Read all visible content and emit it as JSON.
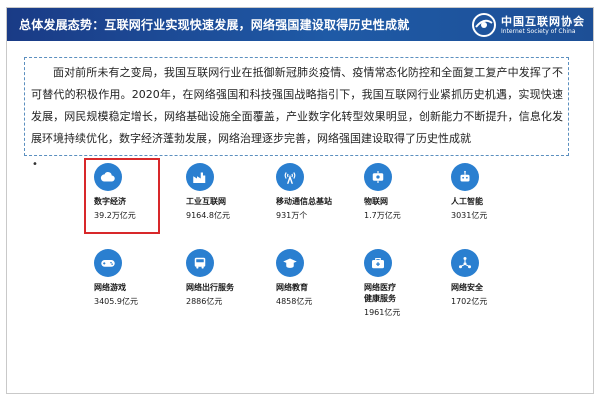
{
  "header": {
    "title": "总体发展态势：互联网行业实现快速发展，网络强国建设取得历史性成就",
    "logo_cn": "中国互联网协会",
    "logo_en": "Internet Society of China"
  },
  "body": {
    "paragraph": "面对前所未有之变局，我国互联网行业在抵御新冠肺炎疫情、疫情常态化防控和全面复工复产中发挥了不可替代的积极作用。2020年，在网络强国和科技强国战略指引下，我国互联网行业紧抓历史机遇，实现快速发展，网民规模稳定增长，网络基础设施全面覆盖，产业数字化转型效果明显，创新能力不断提升，信息化发展环境持续优化，数字经济蓬勃发展，网络治理逐步完善，网络强国建设取得了历史性成就",
    "bullet": "•"
  },
  "stats": [
    {
      "label": "数字经济",
      "value": "39.2万亿元",
      "icon": "cloud-icon"
    },
    {
      "label": "工业互联网",
      "value": "9164.8亿元",
      "icon": "factory-icon"
    },
    {
      "label": "移动通信总基站",
      "value": "931万个",
      "icon": "signal-tower-icon"
    },
    {
      "label": "物联网",
      "value": "1.7万亿元",
      "icon": "iot-icon"
    },
    {
      "label": "人工智能",
      "value": "3031亿元",
      "icon": "robot-icon"
    },
    {
      "label": "网络游戏",
      "value": "3405.9亿元",
      "icon": "gamepad-icon"
    },
    {
      "label": "网络出行服务",
      "value": "2886亿元",
      "icon": "bus-icon"
    },
    {
      "label": "网络教育",
      "value": "4858亿元",
      "icon": "education-icon"
    },
    {
      "label": "网络医疗健康服务",
      "label_line1": "网络医疗",
      "label_line2": "健康服务",
      "value": "1961亿元",
      "icon": "medical-kit-icon"
    },
    {
      "label": "网络安全",
      "value": "1702亿元",
      "icon": "network-security-icon"
    }
  ],
  "colors": {
    "banner": "#1f5aa6",
    "icon": "#2a7fd0",
    "highlight": "#d8282a",
    "border": "#5b8fbf"
  }
}
